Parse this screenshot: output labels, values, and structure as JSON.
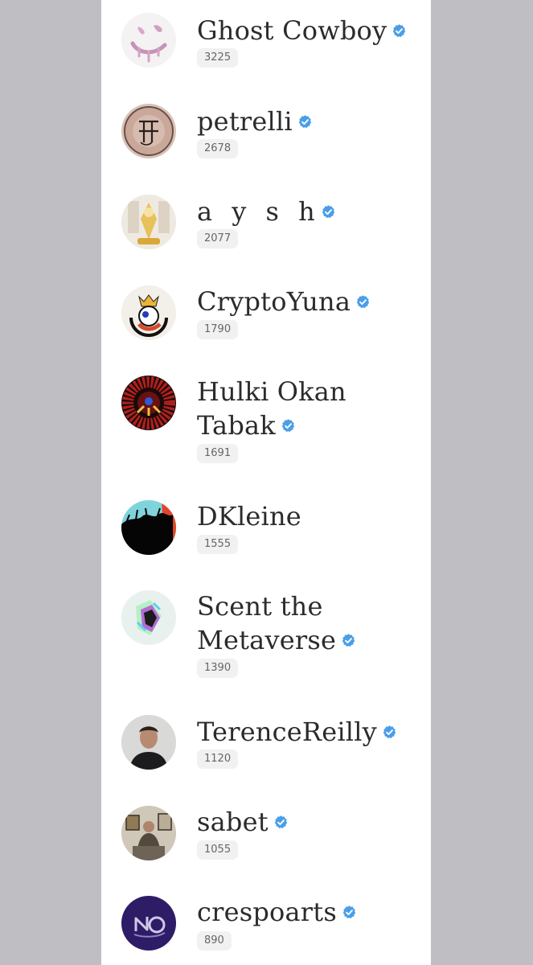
{
  "creators": [
    {
      "name": "Ghost Cowboy",
      "count": "3225",
      "verified": true,
      "avatar_icon": "smiley-drip-avatar"
    },
    {
      "name": "petrelli",
      "count": "2678",
      "verified": true,
      "avatar_icon": "sketch-monogram-avatar"
    },
    {
      "name": "a y s h",
      "count": "2077",
      "verified": true,
      "avatar_icon": "golden-figure-avatar"
    },
    {
      "name": "CryptoYuna",
      "count": "1790",
      "verified": true,
      "avatar_icon": "crowned-character-avatar"
    },
    {
      "name_lines": [
        "Hulki Okan",
        "Tabak"
      ],
      "count": "1691",
      "verified": true,
      "avatar_icon": "red-burst-avatar"
    },
    {
      "name": "DKleine",
      "count": "1555",
      "verified": false,
      "avatar_icon": "dark-silhouette-avatar"
    },
    {
      "name_lines": [
        "Scent the",
        "Metaverse"
      ],
      "count": "1390",
      "verified": true,
      "avatar_icon": "glitch-3d-avatar"
    },
    {
      "name": "TerenceReilly",
      "count": "1120",
      "verified": true,
      "avatar_icon": "portrait-photo-avatar"
    },
    {
      "name": "sabet",
      "count": "1055",
      "verified": true,
      "avatar_icon": "studio-photo-avatar"
    },
    {
      "name": "crespoarts",
      "count": "890",
      "verified": true,
      "avatar_icon": "purple-logo-avatar"
    }
  ],
  "colors": {
    "verified_badge": "#4a9ee8",
    "background": "#bfbec3",
    "panel": "#ffffff"
  }
}
